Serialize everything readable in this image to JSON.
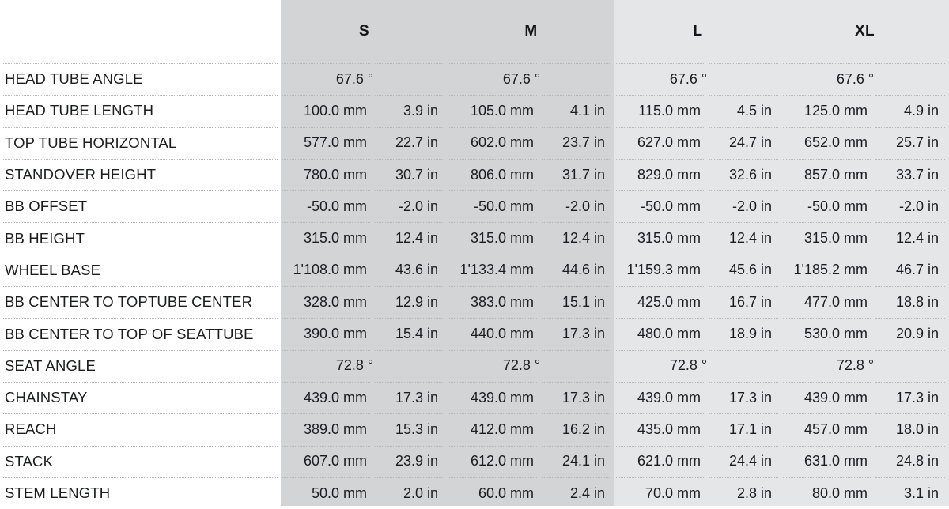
{
  "table": {
    "label_header": "",
    "size_headers": [
      "S",
      "M",
      "L",
      "XL"
    ],
    "units": {
      "mm": "mm",
      "in": "in",
      "deg": "°"
    },
    "colors": {
      "band_sm": "#d2d4d5",
      "band_lxl": "#e4e6e7",
      "text": "#1b1d20",
      "separator": "#b4b6b8",
      "background": "#ffffff"
    },
    "rows": [
      {
        "label": "HEAD TUBE ANGLE",
        "type": "angle",
        "values": [
          {
            "single": "67.6 °"
          },
          {
            "single": "67.6 °"
          },
          {
            "single": "67.6 °"
          },
          {
            "single": "67.6 °"
          }
        ]
      },
      {
        "label": "HEAD TUBE LENGTH",
        "type": "length",
        "values": [
          {
            "mm": "100.0 mm",
            "in": "3.9 in"
          },
          {
            "mm": "105.0 mm",
            "in": "4.1 in"
          },
          {
            "mm": "115.0 mm",
            "in": "4.5 in"
          },
          {
            "mm": "125.0 mm",
            "in": "4.9 in"
          }
        ]
      },
      {
        "label": "TOP TUBE HORIZONTAL",
        "type": "length",
        "values": [
          {
            "mm": "577.0 mm",
            "in": "22.7 in"
          },
          {
            "mm": "602.0 mm",
            "in": "23.7 in"
          },
          {
            "mm": "627.0 mm",
            "in": "24.7 in"
          },
          {
            "mm": "652.0 mm",
            "in": "25.7 in"
          }
        ]
      },
      {
        "label": "STANDOVER HEIGHT",
        "type": "length",
        "values": [
          {
            "mm": "780.0 mm",
            "in": "30.7 in"
          },
          {
            "mm": "806.0 mm",
            "in": "31.7 in"
          },
          {
            "mm": "829.0 mm",
            "in": "32.6 in"
          },
          {
            "mm": "857.0 mm",
            "in": "33.7 in"
          }
        ]
      },
      {
        "label": "BB OFFSET",
        "type": "length",
        "values": [
          {
            "mm": "-50.0 mm",
            "in": "-2.0 in"
          },
          {
            "mm": "-50.0 mm",
            "in": "-2.0 in"
          },
          {
            "mm": "-50.0 mm",
            "in": "-2.0 in"
          },
          {
            "mm": "-50.0 mm",
            "in": "-2.0 in"
          }
        ]
      },
      {
        "label": "BB HEIGHT",
        "type": "length",
        "values": [
          {
            "mm": "315.0 mm",
            "in": "12.4 in"
          },
          {
            "mm": "315.0 mm",
            "in": "12.4 in"
          },
          {
            "mm": "315.0 mm",
            "in": "12.4 in"
          },
          {
            "mm": "315.0 mm",
            "in": "12.4 in"
          }
        ]
      },
      {
        "label": "WHEEL BASE",
        "type": "length",
        "values": [
          {
            "mm": "1'108.0 mm",
            "in": "43.6 in"
          },
          {
            "mm": "1'133.4 mm",
            "in": "44.6 in"
          },
          {
            "mm": "1'159.3 mm",
            "in": "45.6 in"
          },
          {
            "mm": "1'185.2 mm",
            "in": "46.7 in"
          }
        ]
      },
      {
        "label": "BB CENTER TO TOPTUBE CENTER",
        "type": "length",
        "values": [
          {
            "mm": "328.0 mm",
            "in": "12.9 in"
          },
          {
            "mm": "383.0 mm",
            "in": "15.1 in"
          },
          {
            "mm": "425.0 mm",
            "in": "16.7 in"
          },
          {
            "mm": "477.0 mm",
            "in": "18.8 in"
          }
        ]
      },
      {
        "label": "BB CENTER TO TOP OF SEATTUBE",
        "type": "length",
        "values": [
          {
            "mm": "390.0 mm",
            "in": "15.4 in"
          },
          {
            "mm": "440.0 mm",
            "in": "17.3 in"
          },
          {
            "mm": "480.0 mm",
            "in": "18.9 in"
          },
          {
            "mm": "530.0 mm",
            "in": "20.9 in"
          }
        ]
      },
      {
        "label": "SEAT ANGLE",
        "type": "angle",
        "values": [
          {
            "single": "72.8 °"
          },
          {
            "single": "72.8 °"
          },
          {
            "single": "72.8 °"
          },
          {
            "single": "72.8 °"
          }
        ]
      },
      {
        "label": "CHAINSTAY",
        "type": "length",
        "values": [
          {
            "mm": "439.0 mm",
            "in": "17.3 in"
          },
          {
            "mm": "439.0 mm",
            "in": "17.3 in"
          },
          {
            "mm": "439.0 mm",
            "in": "17.3 in"
          },
          {
            "mm": "439.0 mm",
            "in": "17.3 in"
          }
        ]
      },
      {
        "label": "REACH",
        "type": "length",
        "values": [
          {
            "mm": "389.0 mm",
            "in": "15.3 in"
          },
          {
            "mm": "412.0 mm",
            "in": "16.2 in"
          },
          {
            "mm": "435.0 mm",
            "in": "17.1 in"
          },
          {
            "mm": "457.0 mm",
            "in": "18.0 in"
          }
        ]
      },
      {
        "label": "STACK",
        "type": "length",
        "values": [
          {
            "mm": "607.0 mm",
            "in": "23.9 in"
          },
          {
            "mm": "612.0 mm",
            "in": "24.1 in"
          },
          {
            "mm": "621.0 mm",
            "in": "24.4 in"
          },
          {
            "mm": "631.0 mm",
            "in": "24.8 in"
          }
        ]
      },
      {
        "label": "STEM LENGTH",
        "type": "length",
        "values": [
          {
            "mm": "50.0 mm",
            "in": "2.0 in"
          },
          {
            "mm": "60.0 mm",
            "in": "2.4 in"
          },
          {
            "mm": "70.0 mm",
            "in": "2.8 in"
          },
          {
            "mm": "80.0 mm",
            "in": "3.1 in"
          }
        ]
      }
    ]
  }
}
